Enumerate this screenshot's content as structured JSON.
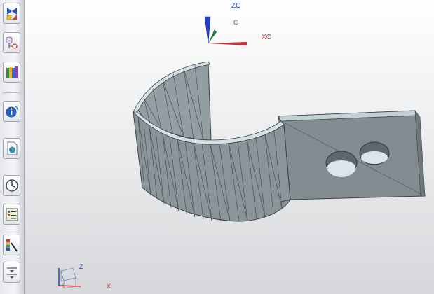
{
  "resource_bar": {
    "buttons": [
      {
        "name": "assembly-navigator-button",
        "icon": "assembly-navigator-icon"
      },
      {
        "name": "constraint-navigator-button",
        "icon": "constraint-navigator-icon"
      },
      {
        "name": "reuse-library-button",
        "icon": "reuse-library-icon"
      },
      {
        "name": "help-button",
        "icon": "info-icon"
      },
      {
        "name": "web-browser-button",
        "icon": "web-browser-icon"
      },
      {
        "name": "history-button",
        "icon": "history-clock-icon"
      },
      {
        "name": "process-studio-button",
        "icon": "process-studio-icon"
      },
      {
        "name": "roles-button",
        "icon": "roles-icon"
      },
      {
        "name": "system-materials-button",
        "icon": "system-materials-icon"
      }
    ]
  },
  "triad": {
    "wcs_z_label": "ZC",
    "wcs_origin_label": "C",
    "wcs_x_label": "XC",
    "abs_z_label": "Z",
    "abs_x_label": "X"
  },
  "colors": {
    "part_face": "#8a9499",
    "part_edge": "#3a4348",
    "hole_face": "#dbe6ea",
    "axis_z": "#2342c8",
    "axis_x": "#c8323a",
    "axis_y": "#1d7a3a"
  }
}
